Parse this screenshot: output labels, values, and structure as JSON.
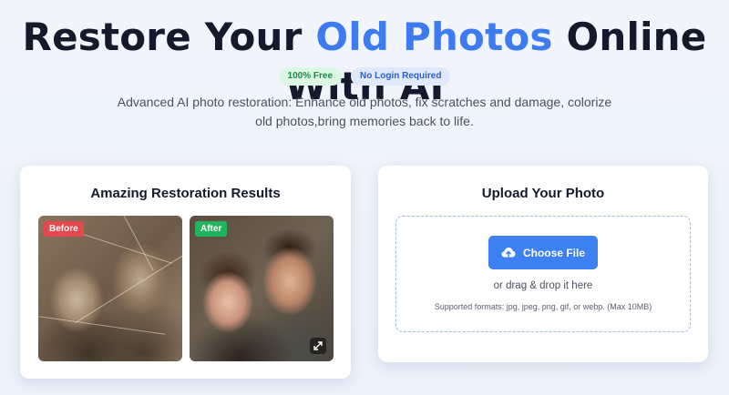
{
  "hero": {
    "title_start": "Restore Your ",
    "title_accent": "Old Photos",
    "title_end": " Online With AI",
    "accent_color": "#3d7bf0"
  },
  "badges": {
    "free": "100% Free",
    "login": "No Login Required"
  },
  "subtitle": "Advanced AI photo restoration: Enhance old photos, fix scratches and damage, colorize old photos,bring memories back to life.",
  "results": {
    "title": "Amazing Restoration Results",
    "before_label": "Before",
    "after_label": "After",
    "expand_icon": "expand-icon"
  },
  "upload": {
    "title": "Upload Your Photo",
    "choose_button": "Choose File",
    "upload_icon": "cloud-upload-icon",
    "drag_text": "or drag & drop it here",
    "formats_text": "Supported formats: jpg, jpeg, png, gif, or webp. (Max 10MB)",
    "button_color": "#3d80f2"
  }
}
